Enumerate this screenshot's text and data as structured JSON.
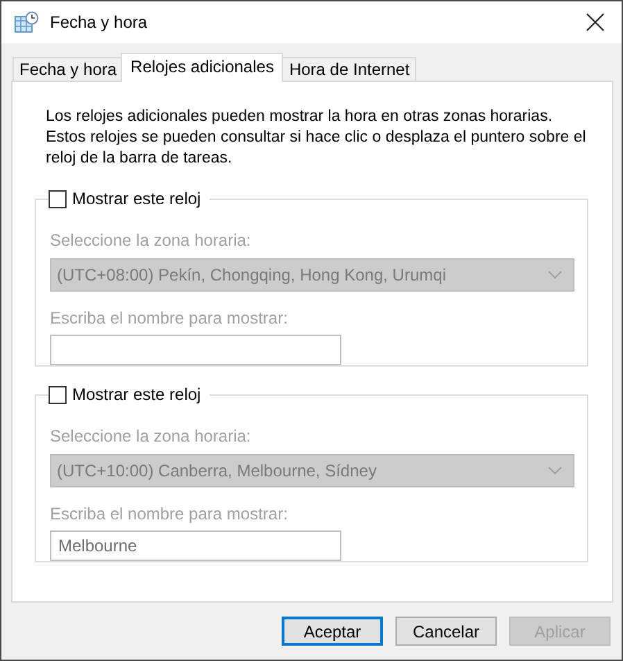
{
  "window": {
    "title": "Fecha y hora"
  },
  "tabs": [
    {
      "label": "Fecha y hora",
      "selected": false
    },
    {
      "label": "Relojes adicionales",
      "selected": true
    },
    {
      "label": "Hora de Internet",
      "selected": false
    }
  ],
  "description": "Los relojes adicionales pueden mostrar la hora en otras zonas horarias. Estos relojes se pueden consultar si hace clic o desplaza el puntero sobre el reloj de la barra de tareas.",
  "clocks": [
    {
      "label": "Mostrar este reloj",
      "checked": false,
      "zone_label": "Seleccione la zona horaria:",
      "zone": "(UTC+08:00) Pekín, Chongqing, Hong Kong, Urumqi",
      "name_label": "Escriba el nombre para mostrar:",
      "disabled": true
    },
    {
      "label": "Mostrar este reloj",
      "checked": false,
      "zone_label": "Seleccione la zona horaria:",
      "zone": "(UTC+10:00) Canberra, Melbourne, Sídney",
      "name_label": "Escriba el nombre para mostrar:",
      "name": "Melbourne",
      "disabled": true
    }
  ],
  "buttons": [
    {
      "label": "Aceptar",
      "default": true,
      "disabled": false
    },
    {
      "label": "Cancelar",
      "default": false,
      "disabled": false
    },
    {
      "label": "Aplicar",
      "default": false,
      "disabled": true
    }
  ]
}
